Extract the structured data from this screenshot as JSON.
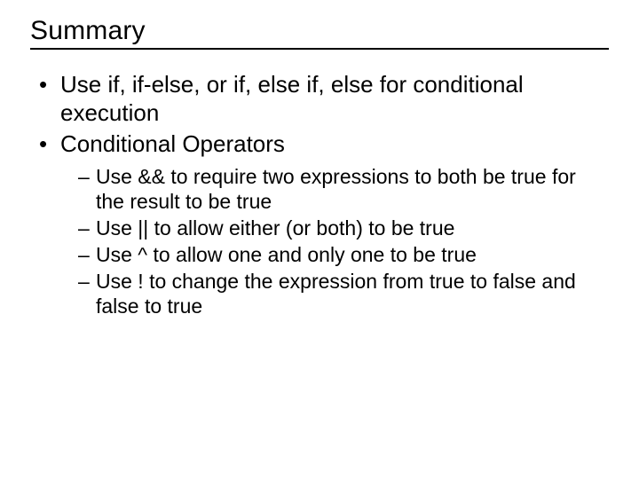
{
  "title": "Summary",
  "bullets": {
    "b0": "Use if, if-else, or if, else if, else for conditional execution",
    "b1": "Conditional Operators",
    "sub": {
      "s0": "Use && to require two expressions to both be true for the result to be true",
      "s1": "Use || to allow either (or both) to be true",
      "s2": "Use ^ to allow one and only one to be true",
      "s3": "Use ! to change the expression from true to false and false to true"
    }
  }
}
